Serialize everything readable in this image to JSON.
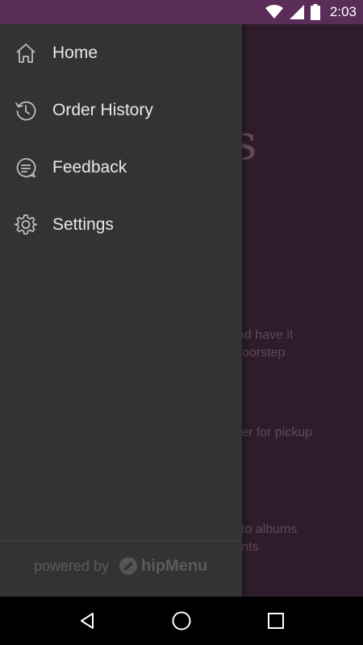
{
  "status_bar": {
    "time": "2:03",
    "icons": [
      "wifi-icon",
      "cell-signal-icon",
      "battery-icon"
    ],
    "color": "#5a2d59"
  },
  "drawer": {
    "items": [
      {
        "label": "Home",
        "icon": "home-icon"
      },
      {
        "label": "Order History",
        "icon": "history-icon"
      },
      {
        "label": "Feedback",
        "icon": "feedback-icon"
      },
      {
        "label": "Settings",
        "icon": "gear-icon"
      }
    ],
    "footer": {
      "powered_by": "powered by",
      "brand": "hipMenu",
      "logo_icon": "hipmenu-logo-icon"
    },
    "background": "#333333"
  },
  "background_content": {
    "glyph": "s",
    "lines": [
      "nd have it",
      "oorstep",
      "er for pickup",
      "to albums",
      "nts"
    ],
    "background": "#2e1c2b"
  },
  "nav_bar": {
    "buttons": [
      "back-icon",
      "home-circle-icon",
      "recents-icon"
    ]
  }
}
